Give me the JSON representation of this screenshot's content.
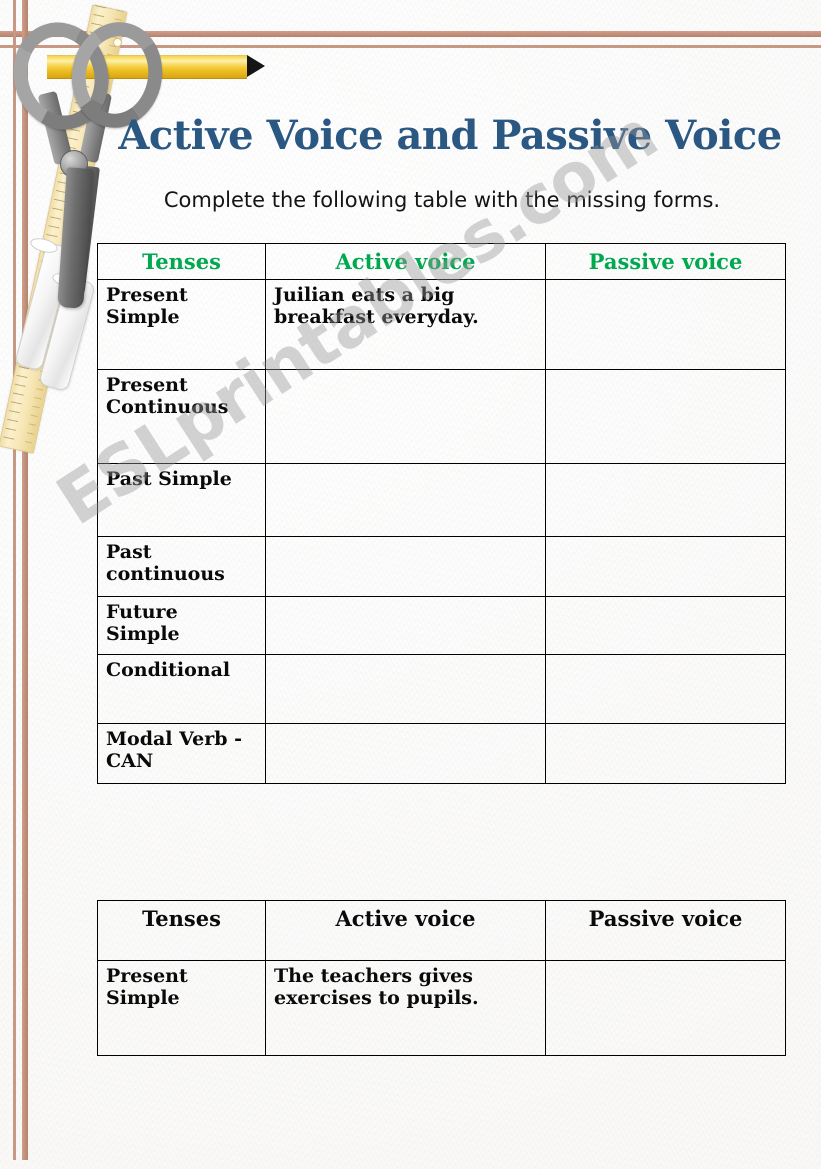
{
  "page": {
    "title": "Active  Voice and Passive Voice",
    "instruction": "Complete the following table with the missing forms.",
    "watermark": "ESLprintables.com",
    "title_color": "#2b5783",
    "header_green": "#00a94f",
    "rule_color": "#c08f7c"
  },
  "clipart": {
    "scissors": "scissors-icon",
    "pencil": "pencil-icon",
    "ruler": "ruler-icon",
    "paper_rolls": "rolled-paper-icon"
  },
  "table_main": {
    "headers": [
      "Tenses",
      "Active voice",
      "Passive voice"
    ],
    "rows": [
      {
        "tense": "Present Simple",
        "active": "Juilian eats a big breakfast everyday.",
        "passive": ""
      },
      {
        "tense": "Present Continuous",
        "active": "",
        "passive": ""
      },
      {
        "tense": "Past Simple",
        "active": "",
        "passive": ""
      },
      {
        "tense": "Past continuous",
        "active": "",
        "passive": ""
      },
      {
        "tense": "Future Simple",
        "active": "",
        "passive": ""
      },
      {
        "tense": "Conditional",
        "active": "",
        "passive": ""
      },
      {
        "tense": "Modal Verb - CAN",
        "active": "",
        "passive": ""
      }
    ]
  },
  "table_second": {
    "headers": [
      "Tenses",
      "Active voice",
      "Passive voice"
    ],
    "rows": [
      {
        "tense": "Present Simple",
        "active": "The teachers gives exercises to pupils.",
        "passive": ""
      }
    ]
  }
}
